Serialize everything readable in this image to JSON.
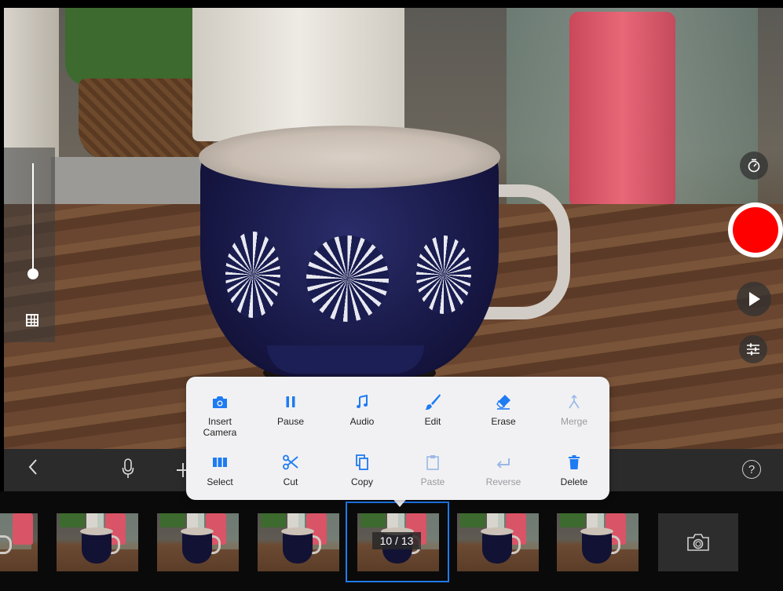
{
  "colors": {
    "accent": "#1e7bf2",
    "record": "#ff0000",
    "disabled": "#9ab8e6",
    "menu_background": "#f1f1f3",
    "toolbar_background": "#2b2b2b"
  },
  "viewfinder": {
    "zoom_level": 0.12
  },
  "toolbar": {
    "back_icon": "chevron-left-icon",
    "mic_icon": "microphone-icon",
    "add_icon": "plus-icon",
    "help_label": "?"
  },
  "action_menu": {
    "items": [
      {
        "label": "Insert Camera",
        "icon": "camera-icon",
        "enabled": true
      },
      {
        "label": "Pause",
        "icon": "pause-icon",
        "enabled": true
      },
      {
        "label": "Audio",
        "icon": "music-note-icon",
        "enabled": true
      },
      {
        "label": "Edit",
        "icon": "brush-icon",
        "enabled": true
      },
      {
        "label": "Erase",
        "icon": "eraser-icon",
        "enabled": true
      },
      {
        "label": "Merge",
        "icon": "merge-icon",
        "enabled": false
      },
      {
        "label": "Select",
        "icon": "select-frames-icon",
        "enabled": true
      },
      {
        "label": "Cut",
        "icon": "scissors-icon",
        "enabled": true
      },
      {
        "label": "Copy",
        "icon": "copy-icon",
        "enabled": true
      },
      {
        "label": "Paste",
        "icon": "clipboard-icon",
        "enabled": false
      },
      {
        "label": "Reverse",
        "icon": "reverse-icon",
        "enabled": false
      },
      {
        "label": "Delete",
        "icon": "trash-icon",
        "enabled": true
      }
    ]
  },
  "filmstrip": {
    "frame_counter": "10 / 13",
    "camera_slot_icon": "camera-icon"
  }
}
